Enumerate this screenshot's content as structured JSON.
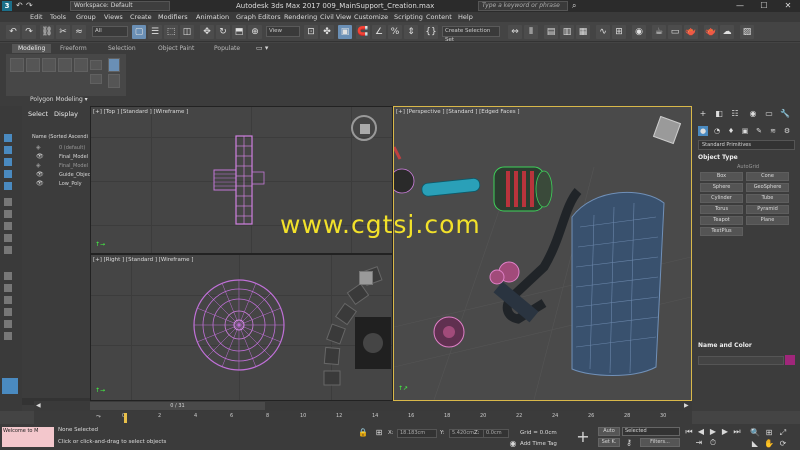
{
  "titlebar": {
    "workspace": "Workspace: Default",
    "app_title": "Autodesk 3ds Max 2017    009_MainSupport_Creation.max",
    "search_placeholder": "Type a keyword or phrase",
    "min_label": "—",
    "max_label": "☐",
    "close_label": "✕"
  },
  "menu": [
    "Edit",
    "Tools",
    "Group",
    "Views",
    "Create",
    "Modifiers",
    "Animation",
    "Graph Editors",
    "Rendering",
    "Civil View",
    "Customize",
    "Scripting",
    "Content",
    "Help"
  ],
  "toolbar": {
    "filter_value": "All",
    "refcoord_value": "View",
    "selection_set": "Create Selection Set"
  },
  "ribbon": {
    "tabs": [
      "Modeling",
      "Freeform",
      "Selection",
      "Object Paint",
      "Populate"
    ],
    "active_tab": "Modeling",
    "panel_label": "Polygon Modeling ▾"
  },
  "explorer": {
    "tabs": [
      "Select",
      "Display"
    ],
    "column_header": "Name (Sorted Ascendi",
    "rows": [
      "0 (default)",
      "Final_Model",
      "Final_Model",
      "Guide_Objec",
      "Low_Poly"
    ]
  },
  "viewports": {
    "top": "[+] [Top ] [Standard ] [Wireframe ]",
    "right": "[+] [Right ] [Standard ] [Wireframe ]",
    "persp": "[+] [Perspective ] [Standard ] [Edged Faces ]"
  },
  "watermark": "www.cgtsj.com",
  "command_panel": {
    "category": "Standard Primitives",
    "object_type_title": "Object Type",
    "autogrid": "AutoGrid",
    "buttons": [
      "Box",
      "Cone",
      "Sphere",
      "GeoSphere",
      "Cylinder",
      "Tube",
      "Torus",
      "Pyramid",
      "Teapot",
      "Plane",
      "TextPlus"
    ],
    "name_color_title": "Name and Color"
  },
  "timeline": {
    "slider": "0 / 31",
    "ticks": [
      "0",
      "2",
      "4",
      "6",
      "8",
      "10",
      "12",
      "14",
      "16",
      "18",
      "20",
      "22",
      "24",
      "26",
      "28",
      "30"
    ]
  },
  "status": {
    "maxscript": "Welcome to M",
    "selected": "None Selected",
    "prompt": "Click or click-and-drag to select objects",
    "x_label": "X:",
    "x_value": "18.183cm",
    "y_label": "Y:",
    "y_value": "5.420cm",
    "z_label": "Z:",
    "z_value": "0.0cm",
    "grid": "Grid = 0.0cm",
    "add_time_tag": "Add Time Tag",
    "auto": "Auto",
    "selected_dd": "Selected",
    "set_key": "Set K.",
    "filters": "Filters..."
  }
}
